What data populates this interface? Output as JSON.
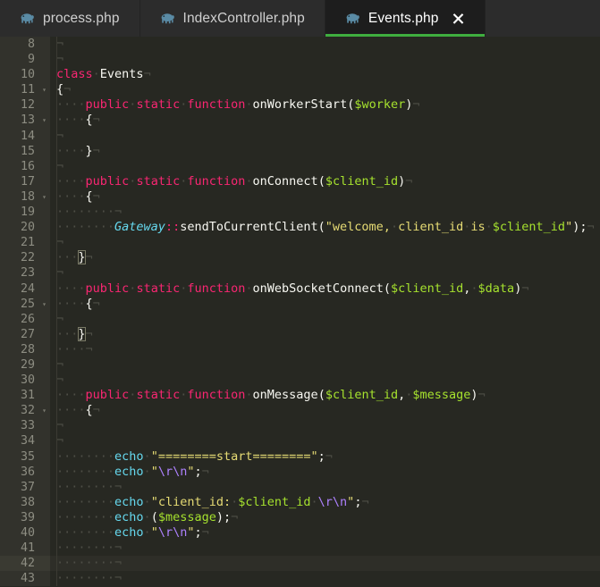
{
  "tabs": [
    {
      "label": "process.php",
      "icon": "php-elephant-icon",
      "active": false,
      "closable": false
    },
    {
      "label": "IndexController.php",
      "icon": "php-elephant-icon",
      "active": false,
      "closable": false
    },
    {
      "label": "Events.php",
      "icon": "php-elephant-icon",
      "active": true,
      "closable": true,
      "close_label": "✖"
    }
  ],
  "theme": {
    "editor_background": "#272822",
    "gutter_background": "#32322c",
    "tabbar_background": "#2c2c2c",
    "active_tab_background": "#1d1d1d",
    "active_tab_accent": "#3fae3f",
    "keyword_color": "#f92672",
    "string_color": "#e6db74",
    "variable_color": "#a6e22e",
    "class_color": "#66d9ef",
    "escape_color": "#ae81ff",
    "text_color": "#f8f8f2",
    "whitespace_marker_color": "#4e4e46",
    "line_number_color": "#8d8d82",
    "current_line_background": "#2e2e28"
  },
  "editor": {
    "language": "php",
    "whitespace_dot": "·",
    "line_end_marker": "¬",
    "fold_marker": "▾",
    "current_line": 42,
    "first_visible_line": 8,
    "last_visible_line": 43,
    "lines": [
      {
        "n": 8,
        "fold": false,
        "cur": false,
        "tokens": [
          {
            "t": "¬",
            "c": "eol"
          }
        ]
      },
      {
        "n": 9,
        "fold": false,
        "cur": false,
        "tokens": [
          {
            "t": "¬",
            "c": "eol"
          }
        ]
      },
      {
        "n": 10,
        "fold": false,
        "cur": false,
        "tokens": [
          {
            "t": "class",
            "c": "kw"
          },
          {
            "t": "·",
            "c": "ws"
          },
          {
            "t": "Events",
            "c": "fn"
          },
          {
            "t": "¬",
            "c": "eol"
          }
        ]
      },
      {
        "n": 11,
        "fold": true,
        "cur": false,
        "tokens": [
          {
            "t": "{",
            "c": "brace"
          },
          {
            "t": "¬",
            "c": "eol"
          }
        ]
      },
      {
        "n": 12,
        "fold": false,
        "cur": false,
        "tokens": [
          {
            "t": "····",
            "c": "ws"
          },
          {
            "t": "public",
            "c": "kw"
          },
          {
            "t": "·",
            "c": "ws"
          },
          {
            "t": "static",
            "c": "kw"
          },
          {
            "t": "·",
            "c": "ws"
          },
          {
            "t": "function",
            "c": "kw"
          },
          {
            "t": "·",
            "c": "ws"
          },
          {
            "t": "onWorkerStart",
            "c": "fn"
          },
          {
            "t": "(",
            "c": "punct"
          },
          {
            "t": "$worker",
            "c": "var"
          },
          {
            "t": ")",
            "c": "punct"
          },
          {
            "t": "¬",
            "c": "eol"
          }
        ]
      },
      {
        "n": 13,
        "fold": true,
        "cur": false,
        "tokens": [
          {
            "t": "····",
            "c": "ws"
          },
          {
            "t": "{",
            "c": "brace"
          },
          {
            "t": "¬",
            "c": "eol"
          }
        ]
      },
      {
        "n": 14,
        "fold": false,
        "cur": false,
        "tokens": [
          {
            "t": "¬",
            "c": "eol"
          }
        ]
      },
      {
        "n": 15,
        "fold": false,
        "cur": false,
        "tokens": [
          {
            "t": "····",
            "c": "ws"
          },
          {
            "t": "}",
            "c": "brace"
          },
          {
            "t": "¬",
            "c": "eol"
          }
        ]
      },
      {
        "n": 16,
        "fold": false,
        "cur": false,
        "tokens": [
          {
            "t": "¬",
            "c": "eol"
          }
        ]
      },
      {
        "n": 17,
        "fold": false,
        "cur": false,
        "tokens": [
          {
            "t": "····",
            "c": "ws"
          },
          {
            "t": "public",
            "c": "kw"
          },
          {
            "t": "·",
            "c": "ws"
          },
          {
            "t": "static",
            "c": "kw"
          },
          {
            "t": "·",
            "c": "ws"
          },
          {
            "t": "function",
            "c": "kw"
          },
          {
            "t": "·",
            "c": "ws"
          },
          {
            "t": "onConnect",
            "c": "fn"
          },
          {
            "t": "(",
            "c": "punct"
          },
          {
            "t": "$client_id",
            "c": "var"
          },
          {
            "t": ")",
            "c": "punct"
          },
          {
            "t": "¬",
            "c": "eol"
          }
        ]
      },
      {
        "n": 18,
        "fold": true,
        "cur": false,
        "tokens": [
          {
            "t": "····",
            "c": "ws"
          },
          {
            "t": "{",
            "c": "brace"
          },
          {
            "t": "¬",
            "c": "eol"
          }
        ]
      },
      {
        "n": 19,
        "fold": false,
        "cur": false,
        "tokens": [
          {
            "t": "········",
            "c": "ws"
          },
          {
            "t": "¬",
            "c": "eol"
          }
        ]
      },
      {
        "n": 20,
        "fold": false,
        "cur": false,
        "tokens": [
          {
            "t": "········",
            "c": "ws"
          },
          {
            "t": "Gateway",
            "c": "cls"
          },
          {
            "t": "::",
            "c": "op"
          },
          {
            "t": "sendToCurrentClient",
            "c": "fn"
          },
          {
            "t": "(",
            "c": "punct"
          },
          {
            "t": "\"welcome,",
            "c": "str"
          },
          {
            "t": "·",
            "c": "ws"
          },
          {
            "t": "client_id",
            "c": "str"
          },
          {
            "t": "·",
            "c": "ws"
          },
          {
            "t": "is",
            "c": "str"
          },
          {
            "t": "·",
            "c": "ws"
          },
          {
            "t": "$client_id",
            "c": "var"
          },
          {
            "t": "\"",
            "c": "str"
          },
          {
            "t": ");",
            "c": "punct"
          },
          {
            "t": "¬",
            "c": "eol"
          }
        ]
      },
      {
        "n": 21,
        "fold": false,
        "cur": false,
        "tokens": [
          {
            "t": "¬",
            "c": "eol"
          }
        ]
      },
      {
        "n": 22,
        "fold": false,
        "cur": false,
        "tokens": [
          {
            "t": "···",
            "c": "ws"
          },
          {
            "t": "}",
            "c": "brace-match"
          },
          {
            "t": "¬",
            "c": "eol"
          }
        ]
      },
      {
        "n": 23,
        "fold": false,
        "cur": false,
        "tokens": [
          {
            "t": "¬",
            "c": "eol"
          }
        ]
      },
      {
        "n": 24,
        "fold": false,
        "cur": false,
        "tokens": [
          {
            "t": "····",
            "c": "ws"
          },
          {
            "t": "public",
            "c": "kw"
          },
          {
            "t": "·",
            "c": "ws"
          },
          {
            "t": "static",
            "c": "kw"
          },
          {
            "t": "·",
            "c": "ws"
          },
          {
            "t": "function",
            "c": "kw"
          },
          {
            "t": "·",
            "c": "ws"
          },
          {
            "t": "onWebSocketConnect",
            "c": "fn"
          },
          {
            "t": "(",
            "c": "punct"
          },
          {
            "t": "$client_id",
            "c": "var"
          },
          {
            "t": ",",
            "c": "punct"
          },
          {
            "t": "·",
            "c": "ws"
          },
          {
            "t": "$data",
            "c": "var"
          },
          {
            "t": ")",
            "c": "punct"
          },
          {
            "t": "¬",
            "c": "eol"
          }
        ]
      },
      {
        "n": 25,
        "fold": true,
        "cur": false,
        "tokens": [
          {
            "t": "····",
            "c": "ws"
          },
          {
            "t": "{",
            "c": "brace"
          },
          {
            "t": "¬",
            "c": "eol"
          }
        ]
      },
      {
        "n": 26,
        "fold": false,
        "cur": false,
        "tokens": [
          {
            "t": "¬",
            "c": "eol"
          }
        ]
      },
      {
        "n": 27,
        "fold": false,
        "cur": false,
        "tokens": [
          {
            "t": "···",
            "c": "ws"
          },
          {
            "t": "}",
            "c": "brace-match"
          },
          {
            "t": "¬",
            "c": "eol"
          }
        ]
      },
      {
        "n": 28,
        "fold": false,
        "cur": false,
        "tokens": [
          {
            "t": "····",
            "c": "ws"
          },
          {
            "t": "¬",
            "c": "eol"
          }
        ]
      },
      {
        "n": 29,
        "fold": false,
        "cur": false,
        "tokens": [
          {
            "t": "¬",
            "c": "eol"
          }
        ]
      },
      {
        "n": 30,
        "fold": false,
        "cur": false,
        "tokens": [
          {
            "t": "¬",
            "c": "eol"
          }
        ]
      },
      {
        "n": 31,
        "fold": false,
        "cur": false,
        "tokens": [
          {
            "t": "····",
            "c": "ws"
          },
          {
            "t": "public",
            "c": "kw"
          },
          {
            "t": "·",
            "c": "ws"
          },
          {
            "t": "static",
            "c": "kw"
          },
          {
            "t": "·",
            "c": "ws"
          },
          {
            "t": "function",
            "c": "kw"
          },
          {
            "t": "·",
            "c": "ws"
          },
          {
            "t": "onMessage",
            "c": "fn"
          },
          {
            "t": "(",
            "c": "punct"
          },
          {
            "t": "$client_id",
            "c": "var"
          },
          {
            "t": ",",
            "c": "punct"
          },
          {
            "t": "·",
            "c": "ws"
          },
          {
            "t": "$message",
            "c": "var"
          },
          {
            "t": ")",
            "c": "punct"
          },
          {
            "t": "¬",
            "c": "eol"
          }
        ]
      },
      {
        "n": 32,
        "fold": true,
        "cur": false,
        "tokens": [
          {
            "t": "····",
            "c": "ws"
          },
          {
            "t": "{",
            "c": "brace"
          },
          {
            "t": "¬",
            "c": "eol"
          }
        ]
      },
      {
        "n": 33,
        "fold": false,
        "cur": false,
        "tokens": [
          {
            "t": "¬",
            "c": "eol"
          }
        ]
      },
      {
        "n": 34,
        "fold": false,
        "cur": false,
        "tokens": [
          {
            "t": "¬",
            "c": "eol"
          }
        ]
      },
      {
        "n": 35,
        "fold": false,
        "cur": false,
        "tokens": [
          {
            "t": "········",
            "c": "ws"
          },
          {
            "t": "echo",
            "c": "echo"
          },
          {
            "t": "·",
            "c": "ws"
          },
          {
            "t": "\"========start========\"",
            "c": "str"
          },
          {
            "t": ";",
            "c": "punct"
          },
          {
            "t": "¬",
            "c": "eol"
          }
        ]
      },
      {
        "n": 36,
        "fold": false,
        "cur": false,
        "tokens": [
          {
            "t": "········",
            "c": "ws"
          },
          {
            "t": "echo",
            "c": "echo"
          },
          {
            "t": "·",
            "c": "ws"
          },
          {
            "t": "\"",
            "c": "str"
          },
          {
            "t": "\\r\\n",
            "c": "esc"
          },
          {
            "t": "\"",
            "c": "str"
          },
          {
            "t": ";",
            "c": "punct"
          },
          {
            "t": "¬",
            "c": "eol"
          }
        ]
      },
      {
        "n": 37,
        "fold": false,
        "cur": false,
        "tokens": [
          {
            "t": "········",
            "c": "ws"
          },
          {
            "t": "¬",
            "c": "eol"
          }
        ]
      },
      {
        "n": 38,
        "fold": false,
        "cur": false,
        "tokens": [
          {
            "t": "········",
            "c": "ws"
          },
          {
            "t": "echo",
            "c": "echo"
          },
          {
            "t": "·",
            "c": "ws"
          },
          {
            "t": "\"client_id:",
            "c": "str"
          },
          {
            "t": "·",
            "c": "ws"
          },
          {
            "t": "$client_id",
            "c": "var"
          },
          {
            "t": "·",
            "c": "ws"
          },
          {
            "t": "\\r\\n",
            "c": "esc"
          },
          {
            "t": "\"",
            "c": "str"
          },
          {
            "t": ";",
            "c": "punct"
          },
          {
            "t": "¬",
            "c": "eol"
          }
        ]
      },
      {
        "n": 39,
        "fold": false,
        "cur": false,
        "tokens": [
          {
            "t": "········",
            "c": "ws"
          },
          {
            "t": "echo",
            "c": "echo"
          },
          {
            "t": "·",
            "c": "ws"
          },
          {
            "t": "(",
            "c": "punct"
          },
          {
            "t": "$message",
            "c": "var"
          },
          {
            "t": ");",
            "c": "punct"
          },
          {
            "t": "¬",
            "c": "eol"
          }
        ]
      },
      {
        "n": 40,
        "fold": false,
        "cur": false,
        "tokens": [
          {
            "t": "········",
            "c": "ws"
          },
          {
            "t": "echo",
            "c": "echo"
          },
          {
            "t": "·",
            "c": "ws"
          },
          {
            "t": "\"",
            "c": "str"
          },
          {
            "t": "\\r\\n",
            "c": "esc"
          },
          {
            "t": "\"",
            "c": "str"
          },
          {
            "t": ";",
            "c": "punct"
          },
          {
            "t": "¬",
            "c": "eol"
          }
        ]
      },
      {
        "n": 41,
        "fold": false,
        "cur": false,
        "tokens": [
          {
            "t": "········",
            "c": "ws"
          },
          {
            "t": "¬",
            "c": "eol"
          }
        ]
      },
      {
        "n": 42,
        "fold": false,
        "cur": true,
        "tokens": [
          {
            "t": "········",
            "c": "ws"
          },
          {
            "t": "¬",
            "c": "eol"
          }
        ]
      },
      {
        "n": 43,
        "fold": false,
        "cur": false,
        "tokens": [
          {
            "t": "········",
            "c": "ws"
          },
          {
            "t": "¬",
            "c": "eol"
          }
        ]
      }
    ]
  }
}
